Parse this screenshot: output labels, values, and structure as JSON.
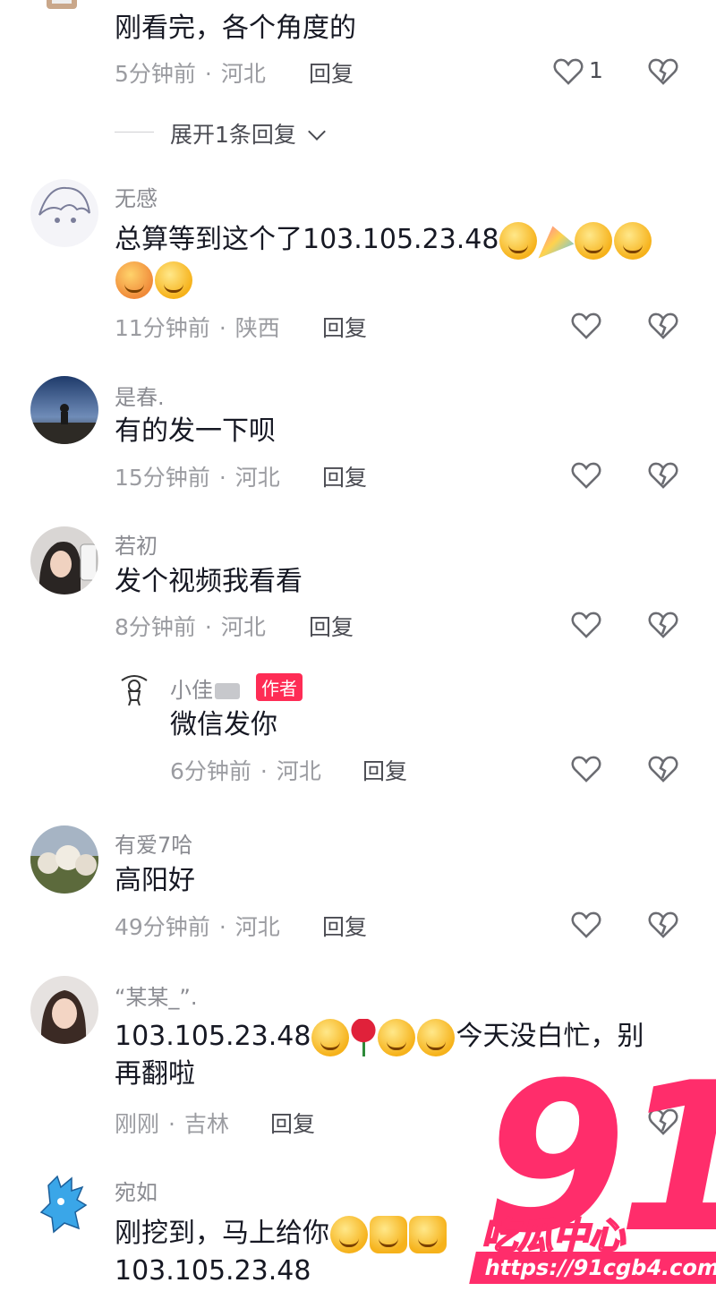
{
  "comments": [
    {
      "name": "",
      "text": "刚看完，各个角度的",
      "time": "5分钟前",
      "region": "河北",
      "reply": "回复",
      "likes": "1",
      "expand": "展开1条回复"
    },
    {
      "name": "无感",
      "text": "总算等到这个了103.105.23.48",
      "time": "11分钟前",
      "region": "陕西",
      "reply": "回复"
    },
    {
      "name": "是春.",
      "text": "有的发一下呗",
      "time": "15分钟前",
      "region": "河北",
      "reply": "回复"
    },
    {
      "name": "若初",
      "text": "发个视频我看看",
      "time": "8分钟前",
      "region": "河北",
      "reply": "回复"
    },
    {
      "name": "小佳",
      "badge": "作者",
      "text": "微信发你",
      "time": "6分钟前",
      "region": "河北",
      "reply": "回复"
    },
    {
      "name": "有爱7哈",
      "text": "高阳好",
      "time": "49分钟前",
      "region": "河北",
      "reply": "回复"
    },
    {
      "name": "“某某_”.",
      "text_line1_a": "103.105.23.48",
      "text_line1_b": "今天没白忙，别",
      "text_line2": "再翻啦",
      "time": "刚刚",
      "region": "吉林",
      "reply": "回复"
    },
    {
      "name": "宛如",
      "text_line1": "刚挖到，马上给你",
      "text_line2": "103.105.23.48"
    }
  ],
  "watermark": {
    "logo": "91",
    "title": "吃瓜中心",
    "url": "https://91cgb4.com"
  },
  "icons": {
    "like": "heart-outline-icon",
    "dislike": "broken-heart-icon"
  },
  "colors": {
    "accent": "#fe2c55",
    "watermark": "#ff2d6b",
    "meta": "#9b9ca1"
  }
}
